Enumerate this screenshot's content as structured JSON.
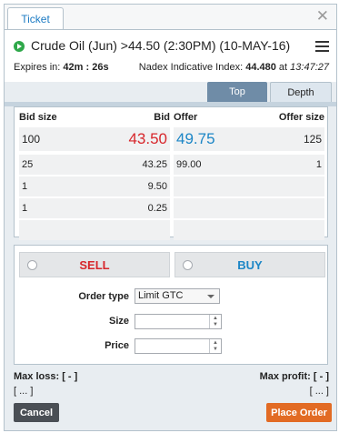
{
  "window": {
    "tab_label": "Ticket",
    "close_glyph": "✕"
  },
  "header": {
    "title": "Crude Oil (Jun) >44.50 (2:30PM) (10-MAY-16)",
    "expires_label": "Expires in:",
    "expires_value": "42m : 26s",
    "indicative_label": "Nadex Indicative Index:",
    "indicative_value": "44.480",
    "indicative_at": "at",
    "indicative_time": "13:47:27"
  },
  "view_tabs": {
    "top": "Top",
    "depth": "Depth",
    "active": "Depth"
  },
  "depth": {
    "bid_size_header": "Bid size",
    "bid_header": "Bid",
    "offer_header": "Offer",
    "offer_size_header": "Offer size",
    "bids": [
      {
        "size": "100",
        "price": "43.50"
      },
      {
        "size": "25",
        "price": "43.25"
      },
      {
        "size": "1",
        "price": "9.50"
      },
      {
        "size": "1",
        "price": "0.25"
      },
      {
        "size": "",
        "price": ""
      }
    ],
    "offers": [
      {
        "price": "49.75",
        "size": "125"
      },
      {
        "price": "99.00",
        "size": "1"
      },
      {
        "price": "",
        "size": ""
      },
      {
        "price": "",
        "size": ""
      },
      {
        "price": "",
        "size": ""
      }
    ]
  },
  "order": {
    "sell_label": "SELL",
    "buy_label": "BUY",
    "order_type_label": "Order type",
    "order_type_value": "Limit GTC",
    "size_label": "Size",
    "price_label": "Price",
    "size_value": "",
    "price_value": ""
  },
  "footer": {
    "max_loss_label": "Max loss:",
    "max_loss_value": "[ - ]",
    "max_loss_detail": "[ ... ]",
    "max_profit_label": "Max profit:",
    "max_profit_value": "[ - ]",
    "max_profit_detail": "[ ... ]",
    "cancel_label": "Cancel",
    "place_label": "Place Order"
  },
  "colors": {
    "bid": "#d7262b",
    "offer": "#1c86c6",
    "accent": "#1c7bc3",
    "place_order": "#e26b24",
    "cancel": "#4a4f55",
    "status_icon": "#2fa84a"
  },
  "icons": {
    "status": "play-circle-icon",
    "menu": "hamburger-menu-icon",
    "close": "close-icon"
  }
}
